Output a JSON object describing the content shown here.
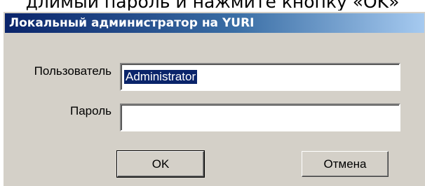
{
  "document": {
    "text": "длимый пароль и нажмите кнопку «OK»"
  },
  "dialog": {
    "title": "Локальный администратор на YURI",
    "user_label": "Пользователь",
    "user_value": "Administrator",
    "password_label": "Пароль",
    "password_value": "",
    "ok_label": "OK",
    "cancel_label": "Отмена"
  },
  "colors": {
    "title_bar_start": "#0a246a",
    "title_bar_end": "#a6caf0",
    "dialog_face": "#d4d0c8",
    "selection": "#0a246a"
  }
}
